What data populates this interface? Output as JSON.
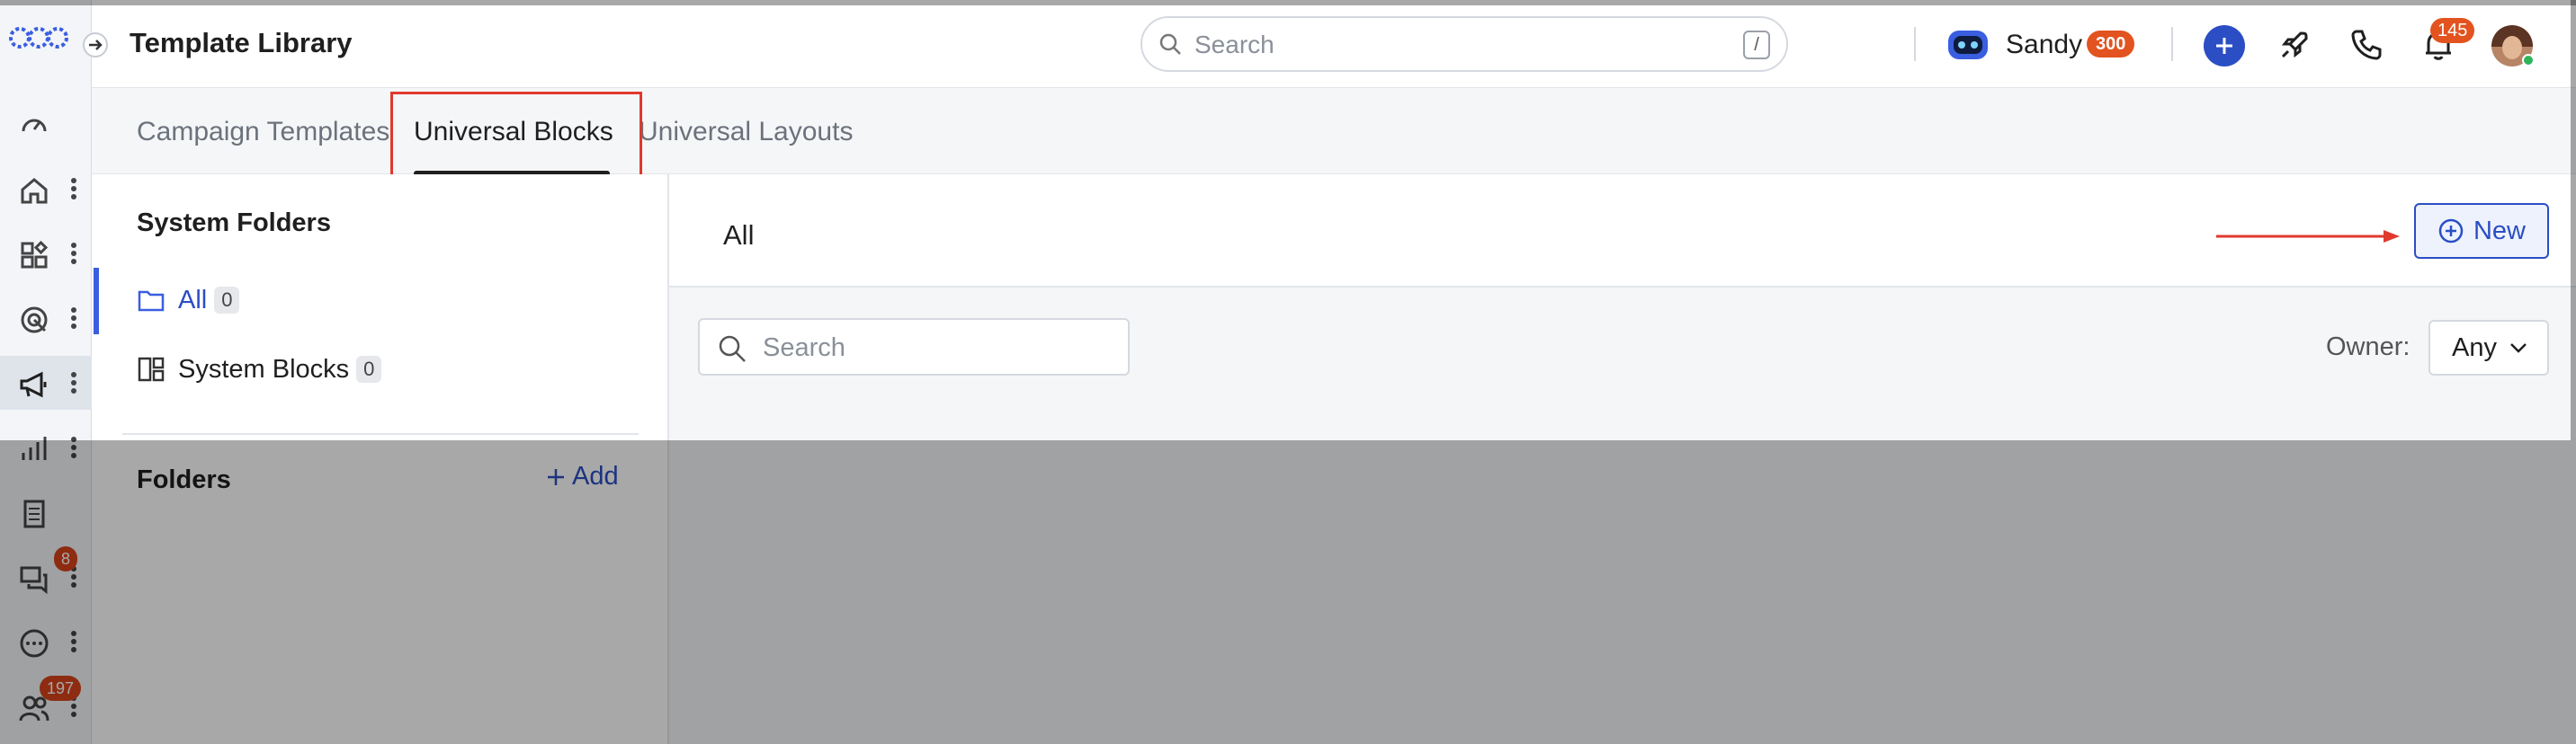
{
  "header": {
    "title": "Template Library",
    "search_placeholder": "Search",
    "search_shortcut": "/",
    "user_name": "Sandy",
    "user_points": "300",
    "notifications_count": "145"
  },
  "rail": {
    "icons": [
      "dashboard-icon",
      "home-icon",
      "apps-icon",
      "target-icon",
      "megaphone-icon",
      "reports-icon",
      "document-icon",
      "chat-icon",
      "more-icon",
      "people-icon"
    ],
    "active": "megaphone-icon",
    "chat_badge": "8",
    "people_badge": "197"
  },
  "tabs": [
    {
      "label": "Campaign Templates",
      "active": false
    },
    {
      "label": "Universal Blocks",
      "active": true
    },
    {
      "label": "Universal Layouts",
      "active": false
    }
  ],
  "sidebar": {
    "system_folders_title": "System Folders",
    "items": [
      {
        "label": "All",
        "count": "0",
        "icon": "folder-icon",
        "active": true
      },
      {
        "label": "System Blocks",
        "count": "0",
        "icon": "blocks-icon",
        "active": false
      }
    ],
    "folders_title": "Folders",
    "add_label": "Add"
  },
  "main": {
    "title": "All",
    "new_button_label": "New",
    "search_placeholder": "Search",
    "owner_label": "Owner:",
    "owner_value": "Any"
  },
  "colors": {
    "accent": "#2b4ec4",
    "highlight": "#e0392e",
    "badge": "#e2531f"
  }
}
